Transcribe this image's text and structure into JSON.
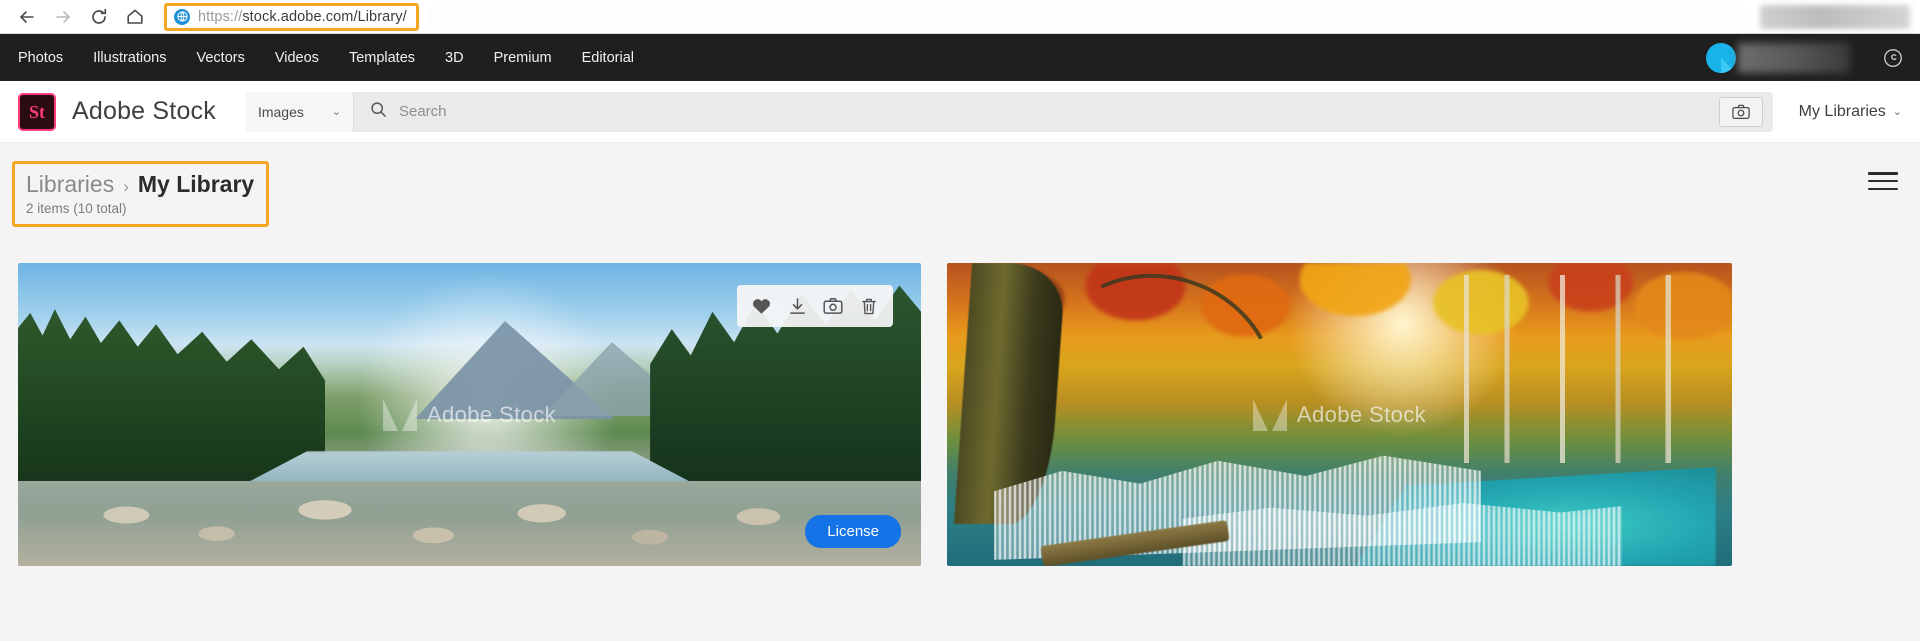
{
  "browser": {
    "back_icon": "back-arrow-icon",
    "forward_icon": "forward-arrow-icon",
    "reload_icon": "reload-icon",
    "home_icon": "home-icon",
    "url_scheme": "https://",
    "url_rest": "stock.adobe.com/Library/",
    "site_icon": "globe-icon",
    "highlight_color": "#F5A623"
  },
  "top_nav": {
    "items": [
      {
        "label": "Photos"
      },
      {
        "label": "Illustrations"
      },
      {
        "label": "Vectors"
      },
      {
        "label": "Videos"
      },
      {
        "label": "Templates"
      },
      {
        "label": "3D"
      },
      {
        "label": "Premium"
      },
      {
        "label": "Editorial"
      }
    ],
    "avatar_color": "#18b4e9",
    "cc_icon": "creative-cloud-icon",
    "background": "#1f1f1f"
  },
  "header": {
    "logo_text": "St",
    "logo_border_color": "#ff3c78",
    "brand": "Adobe Stock",
    "search_type": "Images",
    "search_caret": "⌄",
    "search_placeholder": "Search",
    "search_value": "",
    "search_icon": "magnifier-icon",
    "visual_search_icon": "camera-icon",
    "my_libraries_label": "My Libraries",
    "my_libraries_caret": "⌄"
  },
  "breadcrumb": {
    "parent": "Libraries",
    "separator": "›",
    "current": "My Library",
    "item_count": "2 items (10 total)",
    "highlight_color": "#F5A623"
  },
  "page_menu": {
    "icon": "hamburger-menu-icon"
  },
  "assets": [
    {
      "name": "mountain-river-valley-photo",
      "watermark": "Adobe Stock",
      "toolbar": [
        {
          "icon": "heart-icon",
          "glyph": "♥"
        },
        {
          "icon": "download-icon"
        },
        {
          "icon": "camera-icon"
        },
        {
          "icon": "trash-icon"
        }
      ],
      "license_label": "License",
      "license_color": "#1473e6"
    },
    {
      "name": "autumn-waterfall-photo",
      "watermark": "Adobe Stock"
    }
  ]
}
